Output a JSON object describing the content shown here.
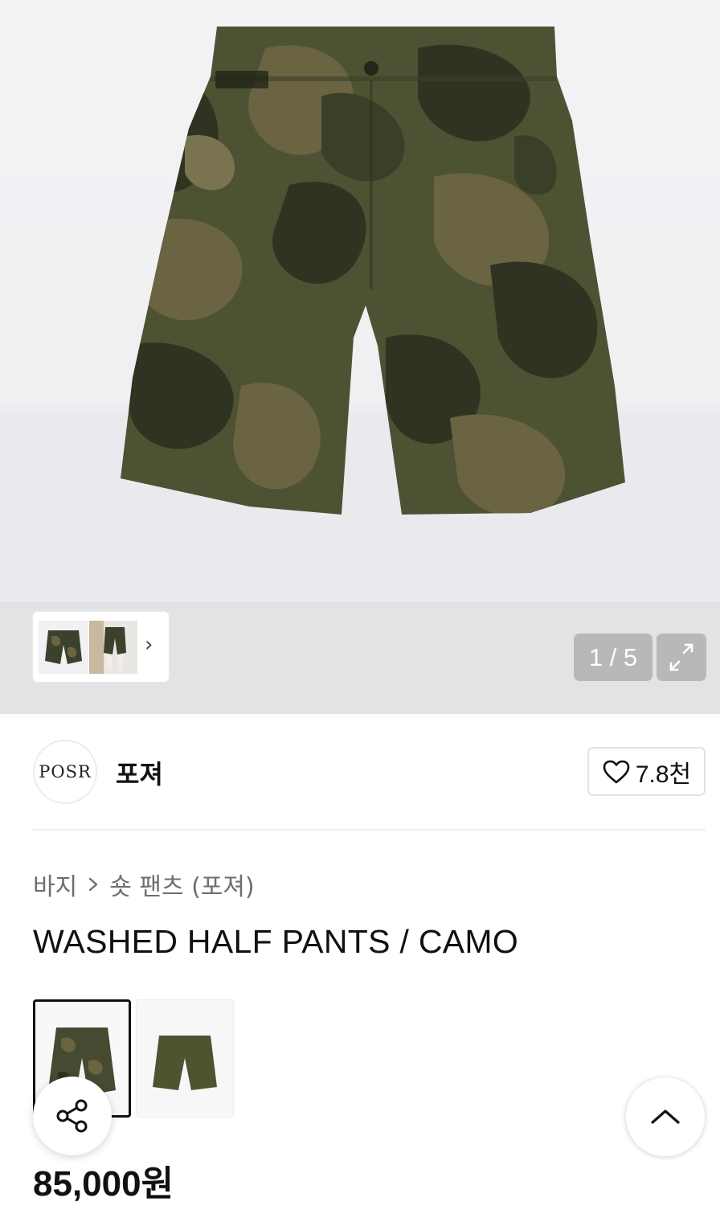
{
  "gallery": {
    "counter": "1 / 5",
    "main_image_icon": "camo-shorts-image",
    "more_icon": "chevron-right-icon",
    "expand_icon": "expand-icon"
  },
  "brand": {
    "logo_text": "POSR",
    "name": "포져",
    "like_count": "7.8천"
  },
  "product": {
    "breadcrumb": [
      "바지",
      "숏 팬츠 (포져)"
    ],
    "breadcrumb_separator_icon": "chevron-right-icon",
    "title": "WASHED HALF PANTS / CAMO",
    "price": "85,000원",
    "color_options": [
      {
        "name": "camo",
        "selected": true
      },
      {
        "name": "olive",
        "selected": false
      }
    ]
  },
  "actions": {
    "share_icon": "share-icon",
    "scroll_top_icon": "chevron-up-icon"
  },
  "colors": {
    "camo_dark": "#2f3422",
    "camo_olive": "#4d5233",
    "camo_light": "#6b6442",
    "olive_solid": "#4f5430",
    "counter_bg": "#b8b8ba"
  }
}
